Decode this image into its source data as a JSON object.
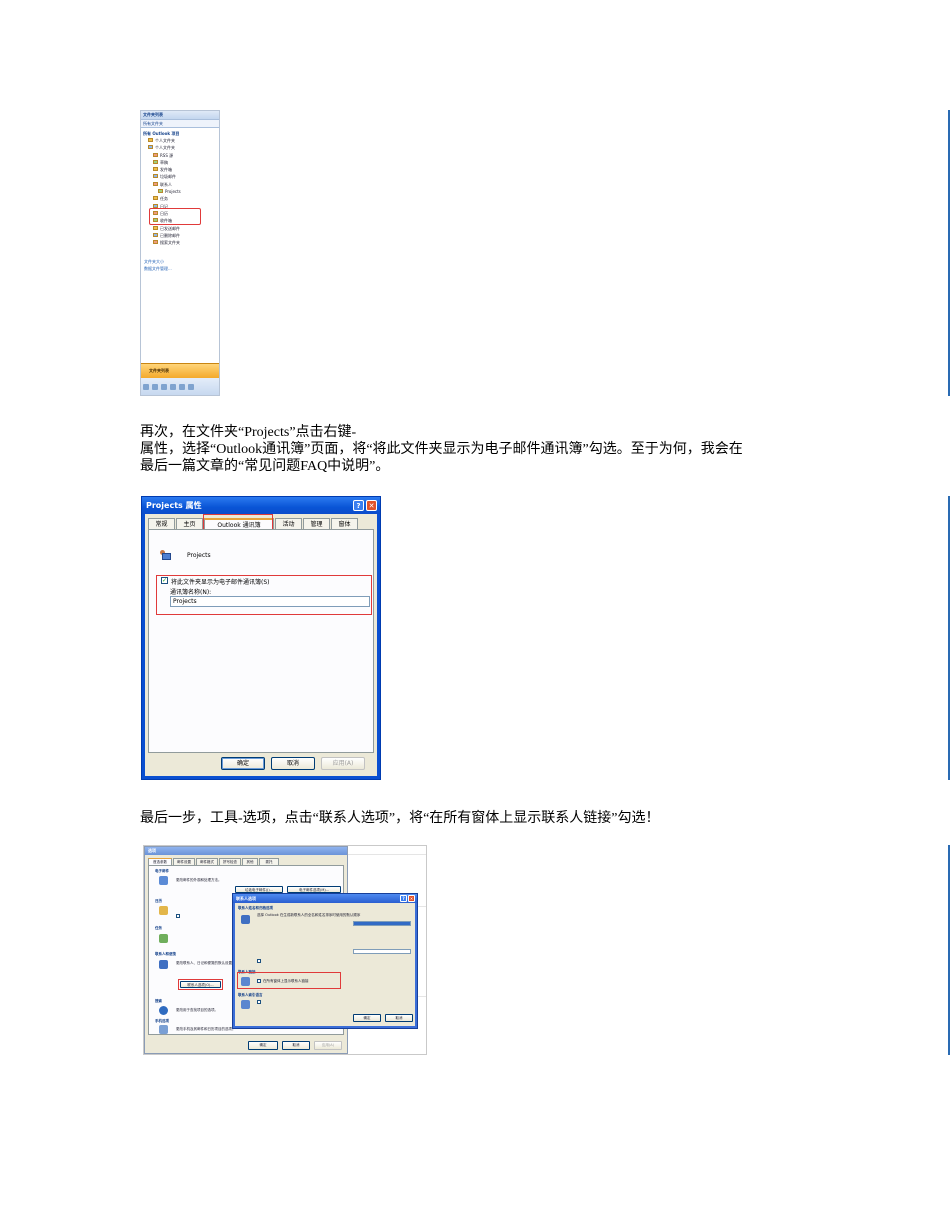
{
  "paragraphs": {
    "p1_line1": "再次，在文件夹“Projects”点击右键-",
    "p1_line2": "属性，选择“Outlook通讯簿”页面，将“将此文件夹显示为电子邮件通讯簿”勾选。至于为何，我会在",
    "p1_line3": "最后一篇文章的“常见问题FAQ中说明”。",
    "p2_line1": "最后一步，工具-选项，点击“联系人选项”，将“在所有窗体上显示联系人链接”勾选！"
  },
  "shot1": {
    "header": "文件夹列表",
    "all_folders": "所有文件夹",
    "group": "所有 Outlook 项目",
    "items": [
      {
        "label": "个人文件夹",
        "indent": 1
      },
      {
        "label": "个人文件夹",
        "indent": 1
      },
      {
        "label": "RSS 源",
        "indent": 2
      },
      {
        "label": "草稿",
        "indent": 2
      },
      {
        "label": "发件箱",
        "indent": 2
      },
      {
        "label": "垃圾邮件",
        "indent": 2
      },
      {
        "label": "联系人",
        "indent": 2
      },
      {
        "label": "Projects",
        "indent": 3
      },
      {
        "label": "任务",
        "indent": 2
      },
      {
        "label": "日记",
        "indent": 2
      },
      {
        "label": "日历",
        "indent": 2
      },
      {
        "label": "收件箱",
        "indent": 2
      },
      {
        "label": "已发送邮件",
        "indent": 2
      },
      {
        "label": "已删除邮件",
        "indent": 2
      },
      {
        "label": "搜索文件夹",
        "indent": 2
      }
    ],
    "links": [
      "文件夹大小",
      "数据文件管理..."
    ],
    "bottom_button": "文件夹列表"
  },
  "shot2": {
    "title": "Projects 属性",
    "tabs": [
      "常规",
      "主页",
      "Outlook 通讯簿",
      "活动",
      "管理",
      "窗体"
    ],
    "selected_tab": 2,
    "folder_name": "Projects",
    "checkbox_label": "将此文件夹显示为电子邮件通讯簿(S)",
    "name_label": "通讯簿名称(N):",
    "name_value": "Projects",
    "buttons": {
      "ok": "确定",
      "cancel": "取消",
      "apply": "应用(A)"
    }
  },
  "shot3": {
    "options_title": "选项",
    "tabs": [
      "首选参数",
      "邮件设置",
      "邮件格式",
      "拼写检查",
      "其他",
      "委托"
    ],
    "sections": {
      "email": "电子邮件",
      "calendar": "日历",
      "tasks": "任务",
      "contacts": "联系人和便笺",
      "search": "搜索",
      "mobile": "手机选项"
    },
    "email_text": "更改邮件的外观和处理方法。",
    "email_buttons": [
      "垃圾电子邮件(J)...",
      "电子邮件选项(M)..."
    ],
    "contacts_text": "更改联系人、日记和便笺的默认设置。",
    "contact_options_button": "联系人选项(O)...",
    "search_text": "更改用于查找项目的选项。",
    "mobile_text": "更改手机及其邮件和日历项目的选项。",
    "option_buttons": [
      "确定",
      "取消",
      "应用(A)"
    ],
    "contact_dialog_title": "联系人选项",
    "cd_section1": "联系人姓名和归档选项",
    "cd_text1": "选择 Outlook 在生成新联系人的全名和姓名排序时使用的默认顺序",
    "cd_section2": "联系人链接",
    "cd_checkbox": "在所有窗体上显示联系人链接",
    "cd_section3": "联系人索引语言",
    "cd_buttons": [
      "确定",
      "取消"
    ]
  }
}
